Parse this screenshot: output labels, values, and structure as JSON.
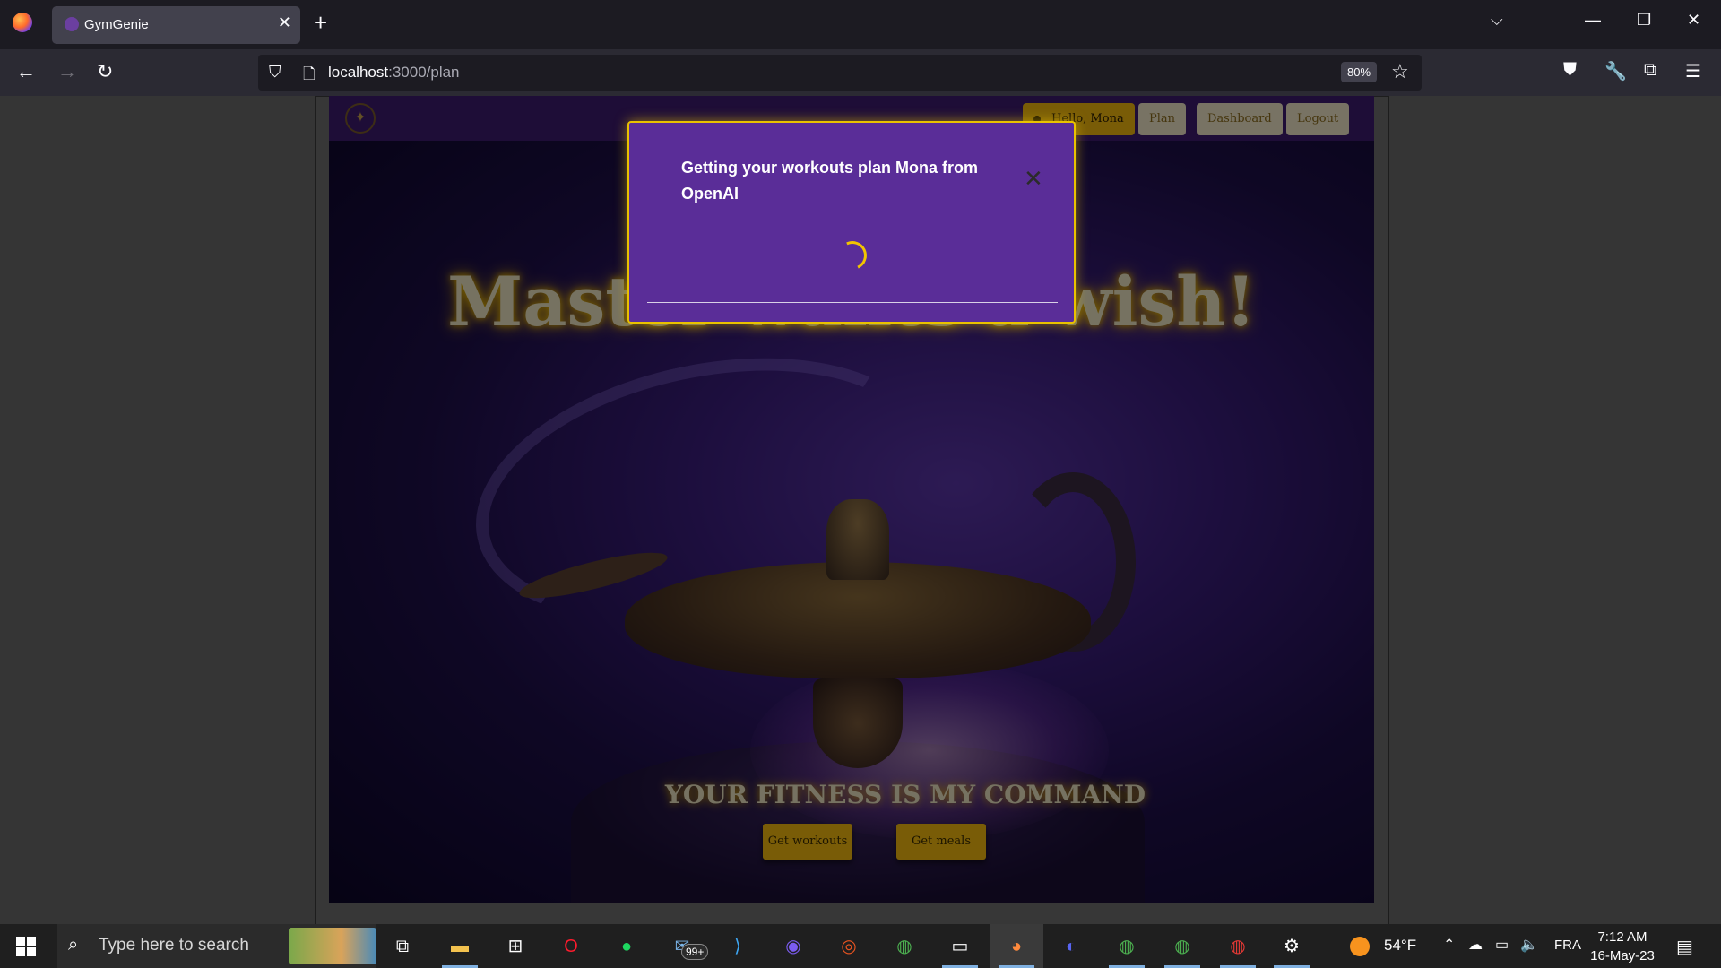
{
  "browser": {
    "tab_title": "GymGenie",
    "url_host": "localhost",
    "url_path": ":3000/plan",
    "zoom": "80%"
  },
  "app": {
    "nav": {
      "user_label": "Hello, Mona",
      "plan_label": "Plan",
      "dashboard_label": "Dashboard",
      "logout_label": "Logout"
    },
    "headline": "Master wants a wish!",
    "tagline": "YOUR FITNESS IS MY COMMAND",
    "cta_workouts": "Get workouts",
    "cta_meals": "Get meals"
  },
  "modal": {
    "title": "Getting your workouts plan Mona from OpenAI",
    "close_glyph": "✕"
  },
  "taskbar": {
    "search_placeholder": "Type here to search",
    "mail_badge": "99+",
    "weather": "54°F",
    "language": "FRA",
    "time": "7:12 AM",
    "date": "16-May-23"
  },
  "colors": {
    "modal_bg": "#5a2d98",
    "modal_border": "#e9c200",
    "accent_gold": "#f2b90f",
    "header_purple": "#3c1b6e"
  }
}
